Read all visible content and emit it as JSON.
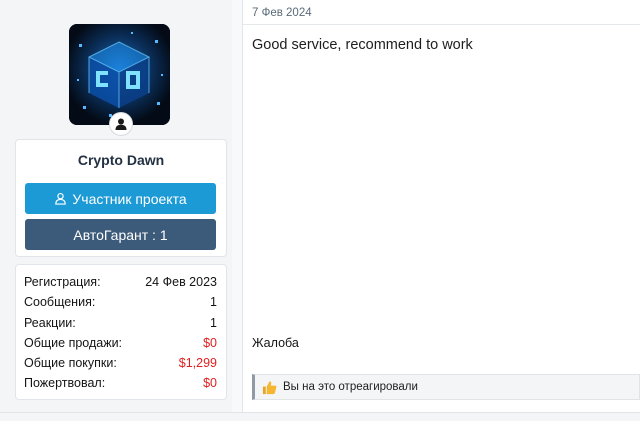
{
  "user": {
    "name": "Crypto Dawn",
    "member_button": "Участник проекта",
    "garant_button": "АвтоГарант : 1"
  },
  "stats": [
    {
      "label": "Регистрация:",
      "value": "24 Фев 2023",
      "color": "#141414"
    },
    {
      "label": "Сообщения:",
      "value": "1",
      "color": "#141414"
    },
    {
      "label": "Реакции:",
      "value": "1",
      "color": "#141414"
    },
    {
      "label": "Общие продажи:",
      "value": "$0",
      "color": "#e02020"
    },
    {
      "label": "Общие покупки:",
      "value": "$1,299",
      "color": "#e02020"
    },
    {
      "label": "Пожертвовал:",
      "value": "$0",
      "color": "#e02020"
    }
  ],
  "post": {
    "date": "7 Фев 2024",
    "body": "Good service, recommend to work",
    "report": "Жалоба",
    "reaction_text": "Вы на это отреагировали"
  },
  "icons": {
    "avatar": "avatar-image",
    "status": "user-status-icon",
    "member": "user-icon",
    "reaction": "thumbs-up-icon"
  },
  "colors": {
    "primary_button": "#1c9ad6",
    "secondary_button": "#3c5a79",
    "money": "#e02020"
  }
}
